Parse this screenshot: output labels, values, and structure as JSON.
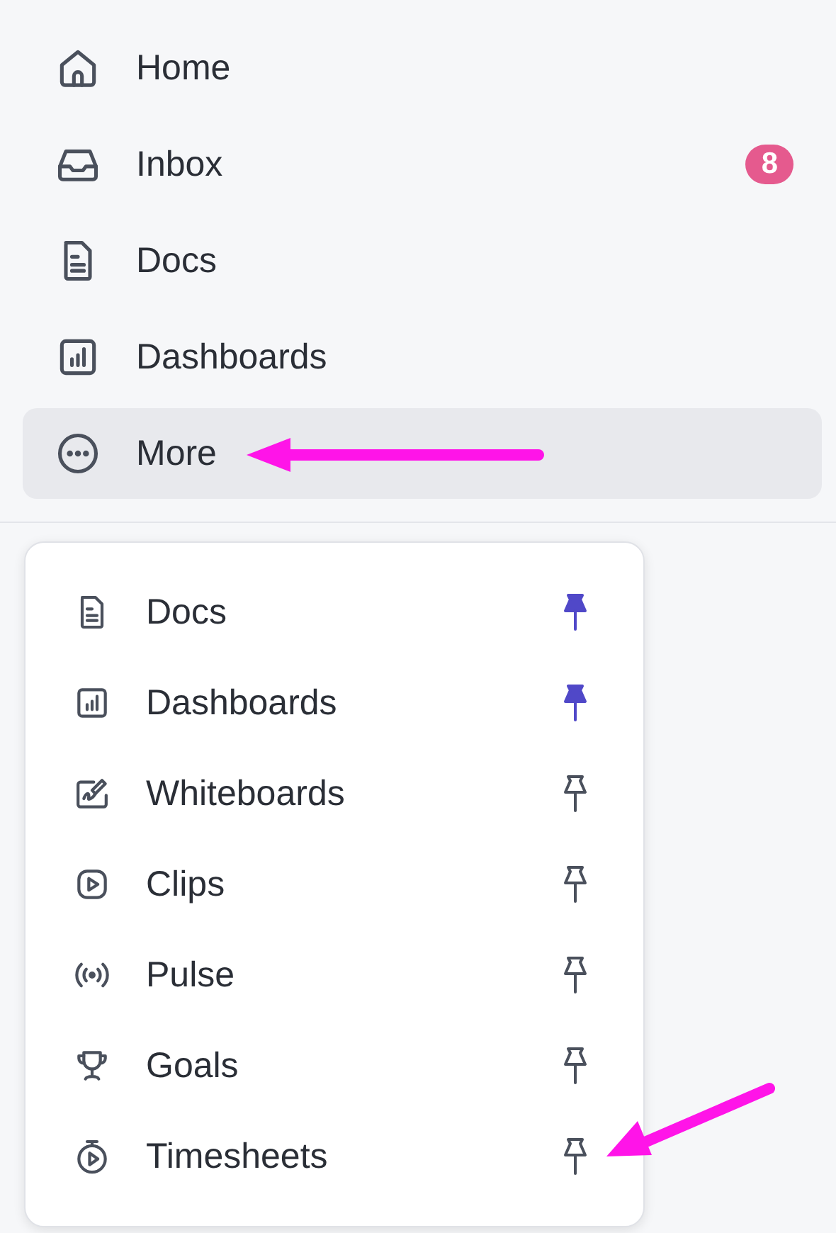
{
  "sidebar": {
    "items": [
      {
        "label": "Home",
        "selected": false
      },
      {
        "label": "Inbox",
        "badge": "8",
        "selected": false
      },
      {
        "label": "Docs",
        "selected": false
      },
      {
        "label": "Dashboards",
        "selected": false
      },
      {
        "label": "More",
        "selected": true
      }
    ]
  },
  "more_menu": {
    "items": [
      {
        "label": "Docs",
        "pinned": true
      },
      {
        "label": "Dashboards",
        "pinned": true
      },
      {
        "label": "Whiteboards",
        "pinned": false
      },
      {
        "label": "Clips",
        "pinned": false
      },
      {
        "label": "Pulse",
        "pinned": false
      },
      {
        "label": "Goals",
        "pinned": false
      },
      {
        "label": "Timesheets",
        "pinned": false
      }
    ]
  }
}
